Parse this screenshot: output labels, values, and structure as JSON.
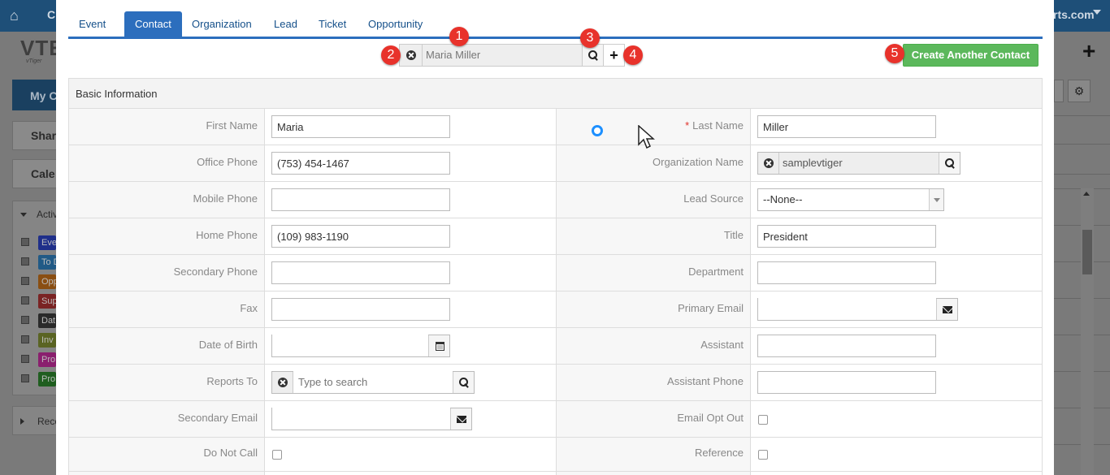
{
  "background": {
    "topbar_partial_left": "C",
    "topbar_partial_right": "rts.com",
    "logo_partial": "VTE",
    "logo_sub_partial": "vTiger",
    "my_button_partial": "My C",
    "share_button_partial": "Shar",
    "calendar_button_partial": "Cale",
    "activity_partial": "Activ",
    "recent_partial": "Rece",
    "calendar_tags": [
      {
        "label": "Eve",
        "color": "#1f2f8a"
      },
      {
        "label": "To D",
        "color": "#215a86"
      },
      {
        "label": "Opp",
        "color": "#8a4e12"
      },
      {
        "label": "Sup",
        "color": "#7a2323"
      },
      {
        "label": "Dat",
        "color": "#2a2a2a"
      },
      {
        "label": "Inv",
        "color": "#5a6423"
      },
      {
        "label": "Pro",
        "color": "#8a1f6e"
      },
      {
        "label": "Pro",
        "color": "#1f5e1f"
      }
    ]
  },
  "tabs": [
    {
      "label": "Event",
      "active": false
    },
    {
      "label": "Contact",
      "active": true
    },
    {
      "label": "Organization",
      "active": false
    },
    {
      "label": "Lead",
      "active": false
    },
    {
      "label": "Ticket",
      "active": false
    },
    {
      "label": "Opportunity",
      "active": false
    }
  ],
  "record": {
    "selected_value": "Maria Miller"
  },
  "create_button_label": "Create Another Contact",
  "badges": [
    "1",
    "2",
    "3",
    "4",
    "5"
  ],
  "section_title": "Basic Information",
  "form": {
    "first_name": {
      "label": "First Name",
      "value": "Maria"
    },
    "last_name": {
      "label": "Last Name",
      "value": "Miller",
      "required_mark": "*"
    },
    "office_phone": {
      "label": "Office Phone",
      "value": "(753) 454-1467"
    },
    "organization_name": {
      "label": "Organization Name",
      "value": "samplevtiger"
    },
    "mobile_phone": {
      "label": "Mobile Phone",
      "value": ""
    },
    "lead_source": {
      "label": "Lead Source",
      "value": "--None--"
    },
    "home_phone": {
      "label": "Home Phone",
      "value": "(109) 983-1190"
    },
    "title": {
      "label": "Title",
      "value": "President"
    },
    "secondary_phone": {
      "label": "Secondary Phone",
      "value": ""
    },
    "department": {
      "label": "Department",
      "value": ""
    },
    "fax": {
      "label": "Fax",
      "value": ""
    },
    "primary_email": {
      "label": "Primary Email",
      "value": ""
    },
    "date_of_birth": {
      "label": "Date of Birth",
      "value": ""
    },
    "assistant": {
      "label": "Assistant",
      "value": ""
    },
    "reports_to": {
      "label": "Reports To",
      "placeholder": "Type to search"
    },
    "assistant_phone": {
      "label": "Assistant Phone",
      "value": ""
    },
    "secondary_email": {
      "label": "Secondary Email",
      "value": ""
    },
    "email_opt_out": {
      "label": "Email Opt Out",
      "checked": false
    },
    "do_not_call": {
      "label": "Do Not Call",
      "checked": false
    },
    "reference": {
      "label": "Reference",
      "checked": false
    }
  }
}
